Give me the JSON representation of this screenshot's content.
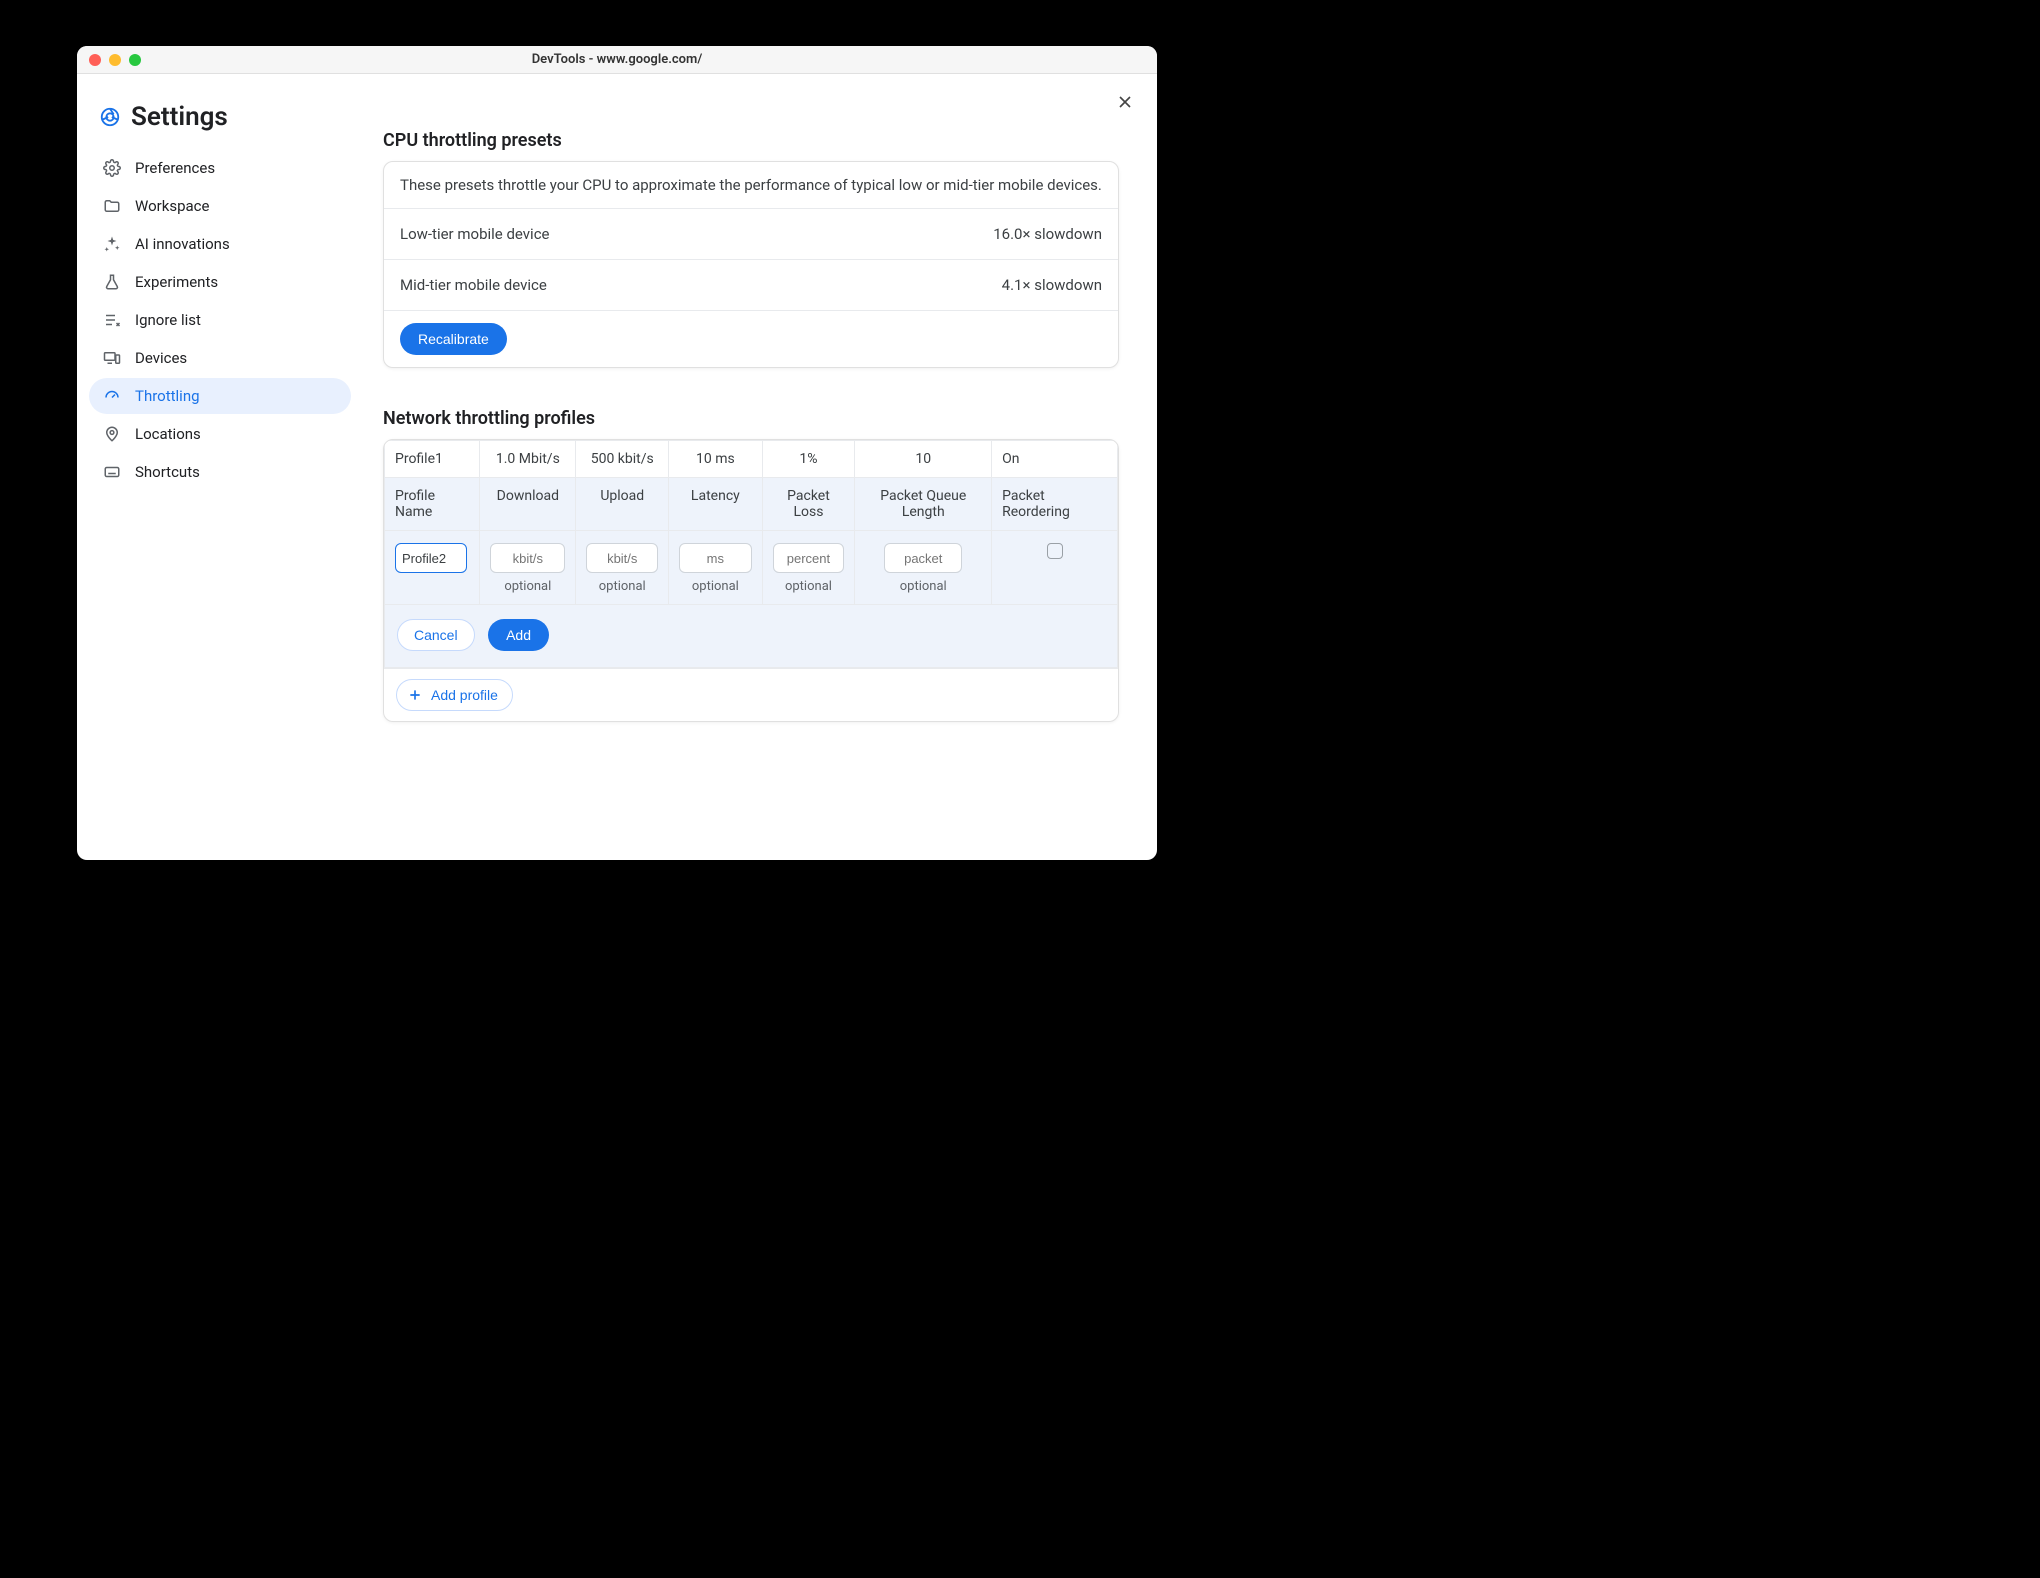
{
  "window": {
    "title": "DevTools - www.google.com/",
    "traffic": {
      "close": "#ff5f57",
      "min": "#febc2e",
      "max": "#28c840"
    }
  },
  "sidebar": {
    "page_title": "Settings",
    "items": [
      {
        "label": "Preferences"
      },
      {
        "label": "Workspace"
      },
      {
        "label": "AI innovations"
      },
      {
        "label": "Experiments"
      },
      {
        "label": "Ignore list"
      },
      {
        "label": "Devices"
      },
      {
        "label": "Throttling"
      },
      {
        "label": "Locations"
      },
      {
        "label": "Shortcuts"
      }
    ],
    "active_index": 6
  },
  "cpu": {
    "heading": "CPU throttling presets",
    "description": "These presets throttle your CPU to approximate the performance of typical low or mid-tier mobile devices.",
    "presets": [
      {
        "name": "Low-tier mobile device",
        "value": "16.0× slowdown"
      },
      {
        "name": "Mid-tier mobile device",
        "value": "4.1× slowdown"
      }
    ],
    "recalibrate": "Recalibrate"
  },
  "network": {
    "heading": "Network throttling profiles",
    "columns": [
      "Profile Name",
      "Download",
      "Upload",
      "Latency",
      "Packet Loss",
      "Packet Queue Length",
      "Packet Reordering"
    ],
    "rows": [
      {
        "name": "Profile1",
        "download": "1.0 Mbit/s",
        "upload": "500 kbit/s",
        "latency": "10 ms",
        "loss": "1%",
        "queue": "10",
        "reorder": "On"
      }
    ],
    "form": {
      "name_value": "Profile2",
      "placeholders": {
        "download": "kbit/s",
        "upload": "kbit/s",
        "latency": "ms",
        "loss": "percent",
        "queue": "packet"
      },
      "optional_label": "optional",
      "cancel": "Cancel",
      "add": "Add"
    },
    "add_profile": "Add profile"
  }
}
